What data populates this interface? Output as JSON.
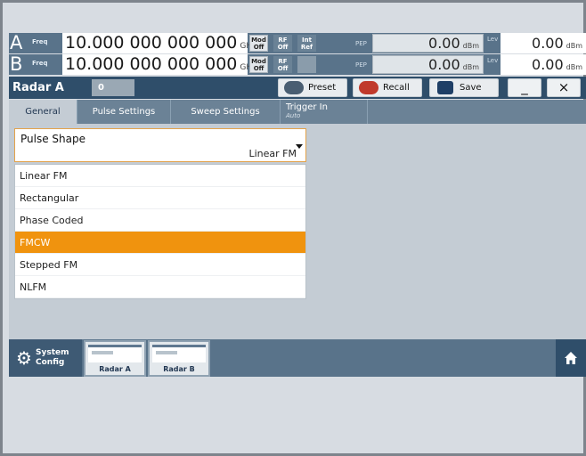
{
  "status": {
    "rows": [
      {
        "channel": "A",
        "freq_label": "Freq",
        "freq_value": "10.000 000 000 000",
        "freq_unit": "GHz",
        "mod": [
          "Mod",
          "Off"
        ],
        "rf": [
          "RF",
          "Off"
        ],
        "extra": [
          "Int",
          "Ref"
        ],
        "pep_label": "PEP",
        "pep_value": "0.00",
        "pep_unit": "dBm",
        "lev_label": "Lev",
        "lev_value": "0.00",
        "lev_unit": "dBm"
      },
      {
        "channel": "B",
        "freq_label": "Freq",
        "freq_value": "10.000 000 000 000",
        "freq_unit": "GHz",
        "mod": [
          "Mod",
          "Off"
        ],
        "rf": [
          "RF",
          "Off"
        ],
        "pep_label": "PEP",
        "pep_value": "0.00",
        "pep_unit": "dBm",
        "lev_label": "Lev",
        "lev_value": "0.00",
        "lev_unit": "dBm"
      }
    ]
  },
  "titlebar": {
    "title": "Radar A",
    "tab_index": "0",
    "preset": "Preset",
    "recall": "Recall",
    "save": "Save",
    "minimize": "_",
    "close": "×"
  },
  "tabs": [
    {
      "label": "General"
    },
    {
      "label": "Pulse Settings"
    },
    {
      "label": "Sweep Settings"
    },
    {
      "label": "Trigger In",
      "sub": "Auto"
    }
  ],
  "pulse_shape": {
    "label": "Pulse Shape",
    "value": "Linear FM",
    "options": [
      "Linear FM",
      "Rectangular",
      "Phase Coded",
      "FMCW",
      "Stepped FM",
      "NLFM"
    ],
    "highlighted": "FMCW"
  },
  "taskbar": {
    "system_config": [
      "System",
      "Config"
    ],
    "windows": [
      "Radar A",
      "Radar B"
    ]
  },
  "colors": {
    "status_bar": "#59738a",
    "title_bar": "#2f4e6a",
    "highlight": "#f0930e",
    "content_bg": "#c4ccd4"
  }
}
